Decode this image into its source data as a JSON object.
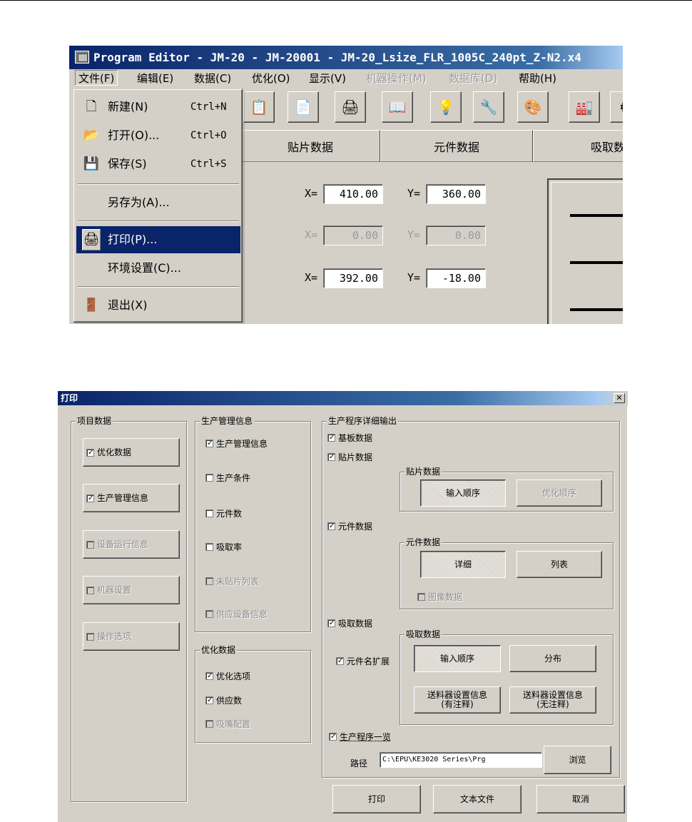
{
  "screenshot1": {
    "window_title": "Program Editor - JM-20 - JM-20001 - JM-20_Lsize_FLR_1005C_240pt_Z-N2.x4",
    "menubar": [
      {
        "label": "文件(F)",
        "enabled": true,
        "open": true
      },
      {
        "label": "编辑(E)",
        "enabled": true
      },
      {
        "label": "数据(C)",
        "enabled": true
      },
      {
        "label": "优化(O)",
        "enabled": true
      },
      {
        "label": "显示(V)",
        "enabled": true
      },
      {
        "label": "机器操作(M)",
        "enabled": false
      },
      {
        "label": "数据库(D)",
        "enabled": false
      },
      {
        "label": "帮助(H)",
        "enabled": true
      }
    ],
    "file_menu": [
      {
        "label": "新建(N)",
        "shortcut": "Ctrl+N",
        "icon": "new-document-icon"
      },
      {
        "label": "打开(O)...",
        "shortcut": "Ctrl+O",
        "icon": "open-folder-icon"
      },
      {
        "label": "保存(S)",
        "shortcut": "Ctrl+S",
        "icon": "save-disk-icon"
      },
      {
        "label": "另存为(A)..."
      },
      {
        "label": "打印(P)...",
        "icon": "printer-icon",
        "selected": true
      },
      {
        "label": "环境设置(C)..."
      },
      {
        "label": "退出(X)",
        "icon": "exit-door-icon"
      }
    ],
    "tabs": [
      "贴片数据",
      "元件数据",
      "吸取数"
    ],
    "fields": [
      {
        "x_label": "X=",
        "x_value": "410.00",
        "y_label": "Y=",
        "y_value": "360.00",
        "enabled": true
      },
      {
        "x_label": "X=",
        "x_value": "0.00",
        "y_label": "Y=",
        "y_value": "0.00",
        "enabled": false
      },
      {
        "x_label": "X=",
        "x_value": "392.00",
        "y_label": "Y=",
        "y_value": "-18.00",
        "enabled": true
      }
    ]
  },
  "print_dialog": {
    "title": "打印",
    "close_glyph": "✕",
    "item_data": {
      "title": "项目数据",
      "buttons": [
        {
          "label": "优化数据",
          "checked": true,
          "enabled": true
        },
        {
          "label": "生产管理信息",
          "checked": true,
          "enabled": true
        },
        {
          "label": "设备运行信息",
          "checked": false,
          "enabled": false
        },
        {
          "label": "机器设置",
          "checked": false,
          "enabled": false
        },
        {
          "label": "操作选项",
          "checked": false,
          "enabled": false
        }
      ]
    },
    "production_mgmt": {
      "title": "生产管理信息",
      "items": [
        {
          "label": "生产管理信息",
          "checked": true,
          "enabled": true
        },
        {
          "label": "生产条件",
          "checked": false,
          "enabled": true
        },
        {
          "label": "元件数",
          "checked": false,
          "enabled": true
        },
        {
          "label": "吸取率",
          "checked": false,
          "enabled": true
        },
        {
          "label": "未贴片列表",
          "checked": false,
          "enabled": false
        },
        {
          "label": "供应设备信息",
          "checked": false,
          "enabled": false
        }
      ]
    },
    "optimization": {
      "title": "优化数据",
      "items": [
        {
          "label": "优化选项",
          "checked": true,
          "enabled": true
        },
        {
          "label": "供应数",
          "checked": true,
          "enabled": true
        },
        {
          "label": "吸嘴配置",
          "checked": false,
          "enabled": false
        }
      ]
    },
    "detail_output": {
      "title": "生产程序详细输出",
      "board_data": {
        "label": "基板数据",
        "checked": true
      },
      "placement_data": {
        "label": "贴片数据",
        "checked": true
      },
      "placement_group": {
        "title": "贴片数据",
        "btn_input_order": "输入顺序",
        "btn_opt_order": "优化顺序"
      },
      "component_data": {
        "label": "元件数据",
        "checked": true
      },
      "component_group": {
        "title": "元件数据",
        "btn_detail": "详细",
        "btn_list": "列表",
        "image_data": "图像数据"
      },
      "pickup_data": {
        "label": "吸取数据",
        "checked": true
      },
      "pickup_group": {
        "title": "吸取数据",
        "btn_input_order": "输入顺序",
        "btn_distribution": "分布",
        "btn_feeder_with_notes": "送料器设置信息\n(有注释)",
        "btn_feeder_no_notes": "送料器设置信息\n(无注释)"
      },
      "component_name_ext": {
        "label": "元件名扩展",
        "checked": true
      },
      "program_list": {
        "label": "生产程序一览",
        "checked": true
      },
      "path_label": "路径",
      "path_value": "C:\\EPU\\KE3020 Series\\Prg",
      "browse": "浏览"
    },
    "bottom_buttons": {
      "print": "打印",
      "text_file": "文本文件",
      "cancel": "取消"
    }
  }
}
